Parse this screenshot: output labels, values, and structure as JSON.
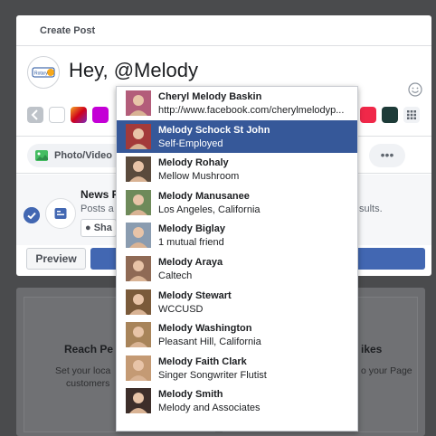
{
  "composer": {
    "tab_label": "Create Post",
    "post_text": "Hey, @Melody",
    "photo_video_label": "Photo/Video",
    "more_label": "•••",
    "preview_label": "Preview"
  },
  "page_avatar": {
    "logo_text": "Rotary"
  },
  "newsfeed": {
    "title": "News F",
    "description": "Posts a",
    "description_end": "sults.",
    "share_label": "Sha"
  },
  "background": {
    "left_title": "Reach Pe",
    "left_text_1": "Set your loca",
    "left_text_2": "customers",
    "right_title": "ikes",
    "right_text_1": "o your Page"
  },
  "mentions": [
    {
      "name": "Cheryl Melody Baskin",
      "subtitle": "http://www.facebook.com/cherylmelodyp...",
      "selected": false,
      "color": "#b35d7a"
    },
    {
      "name": "Melody Schock St John",
      "subtitle": "Self-Employed",
      "selected": true,
      "color": "#a33a3a"
    },
    {
      "name": "Melody Rohaly",
      "subtitle": "Mellow Mushroom",
      "selected": false,
      "color": "#5a4a3c"
    },
    {
      "name": "Melody Manusanee",
      "subtitle": "Los Angeles, California",
      "selected": false,
      "color": "#6e8a5a"
    },
    {
      "name": "Melody Biglay",
      "subtitle": "1 mutual friend",
      "selected": false,
      "color": "#8a9cb0"
    },
    {
      "name": "Melody Araya",
      "subtitle": "Caltech",
      "selected": false,
      "color": "#8f6a55"
    },
    {
      "name": "Melody Stewart",
      "subtitle": "WCCUSD",
      "selected": false,
      "color": "#7a5a3a"
    },
    {
      "name": "Melody Washington",
      "subtitle": "Pleasant Hill, California",
      "selected": false,
      "color": "#a8845a"
    },
    {
      "name": "Melody Faith Clark",
      "subtitle": "Singer Songwriter Flutist",
      "selected": false,
      "color": "#c49a74"
    },
    {
      "name": "Melody Smith",
      "subtitle": "Melody and Associates",
      "selected": false,
      "color": "#3d2e2a"
    }
  ],
  "colors": {
    "accent": "#4267b2",
    "selected_row": "#365899"
  }
}
